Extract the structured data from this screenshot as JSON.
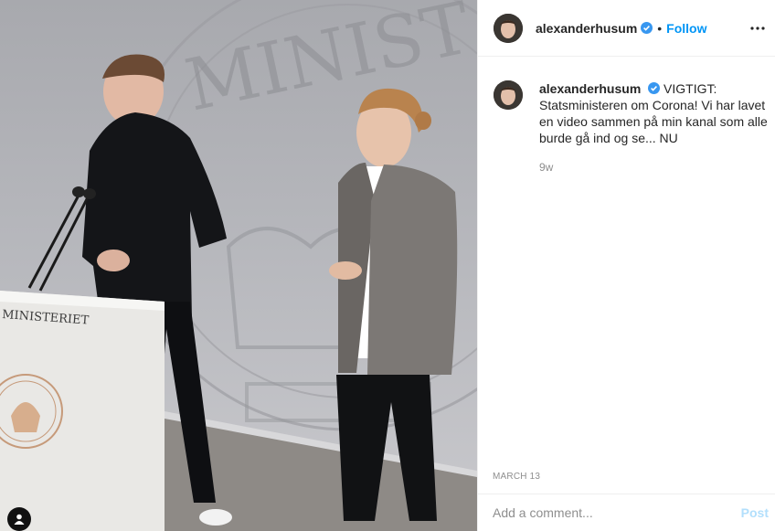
{
  "header": {
    "username": "alexanderhusum",
    "separator": "•",
    "follow_label": "Follow",
    "verified_icon": "verified-badge-icon",
    "more_icon": "more-options-icon"
  },
  "photo": {
    "podium_text": "MINISTERIET",
    "seal_text": "MINISTERIET",
    "backdrop_text": "MINIST",
    "tag_icon": "user-tag-icon"
  },
  "caption": {
    "username": "alexanderhusum",
    "text": "VIGTIGT: Statsministeren om Corona! Vi har lavet en video sammen på min kanal som alle burde gå ind og se... NU",
    "age": "9w"
  },
  "post": {
    "date": "MARCH 13"
  },
  "comment": {
    "placeholder": "Add a comment...",
    "post_label": "Post"
  },
  "colors": {
    "link_blue": "#0095f6",
    "post_disabled": "#b2dffc",
    "muted": "#8e8e8e",
    "verified": "#3897f0"
  }
}
